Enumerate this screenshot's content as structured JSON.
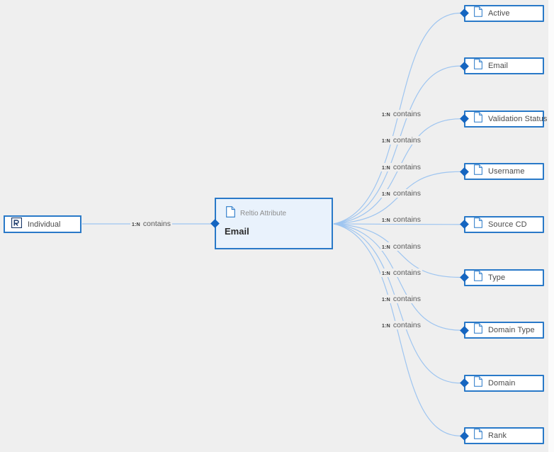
{
  "diagram": {
    "background_color": "#efefef",
    "accent_color": "#2979c8",
    "connector_color": "#1565c0",
    "edge_color": "#9ec5f0",
    "root": {
      "label": "Individual",
      "icon": "reltio-r-logo"
    },
    "focus_node": {
      "type_label": "Reltio Attribute",
      "title": "Email",
      "icon": "document-icon"
    },
    "root_edge": {
      "cardinality": "1:N",
      "verb": "contains"
    },
    "attributes": [
      {
        "label": "Active",
        "icon": "document-icon",
        "cardinality": "1:N",
        "verb": "contains"
      },
      {
        "label": "Email",
        "icon": "document-icon",
        "cardinality": "1:N",
        "verb": "contains"
      },
      {
        "label": "Validation Status",
        "icon": "document-icon",
        "cardinality": "1:N",
        "verb": "contains"
      },
      {
        "label": "Username",
        "icon": "document-icon",
        "cardinality": "1:N",
        "verb": "contains"
      },
      {
        "label": "Source CD",
        "icon": "document-icon",
        "cardinality": "1:N",
        "verb": "contains"
      },
      {
        "label": "Type",
        "icon": "document-icon",
        "cardinality": "1:N",
        "verb": "contains"
      },
      {
        "label": "Domain Type",
        "icon": "document-icon",
        "cardinality": "1:N",
        "verb": "contains"
      },
      {
        "label": "Domain",
        "icon": "document-icon",
        "cardinality": "1:N",
        "verb": "contains"
      },
      {
        "label": "Rank",
        "icon": "document-icon",
        "cardinality": "1:N",
        "verb": "contains"
      }
    ]
  }
}
